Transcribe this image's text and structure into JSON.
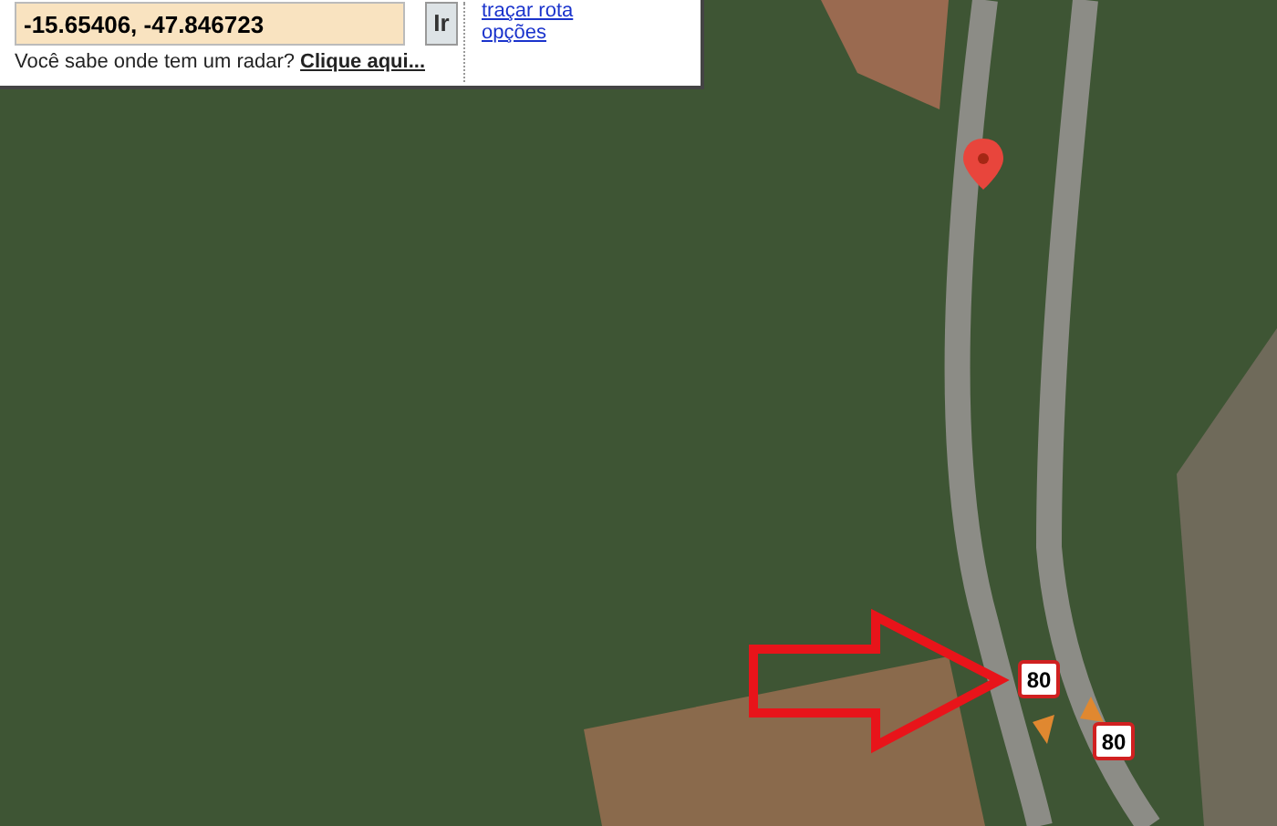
{
  "search": {
    "value": "-15.65406, -47.846723",
    "button": "Ir"
  },
  "links": [
    "traçar rota",
    "opções"
  ],
  "radar_prompt": {
    "text": "Você sabe onde tem um radar?",
    "link": "Clique aqui..."
  },
  "map": {
    "speed_signs": [
      {
        "label": "80"
      },
      {
        "label": "80"
      }
    ]
  }
}
